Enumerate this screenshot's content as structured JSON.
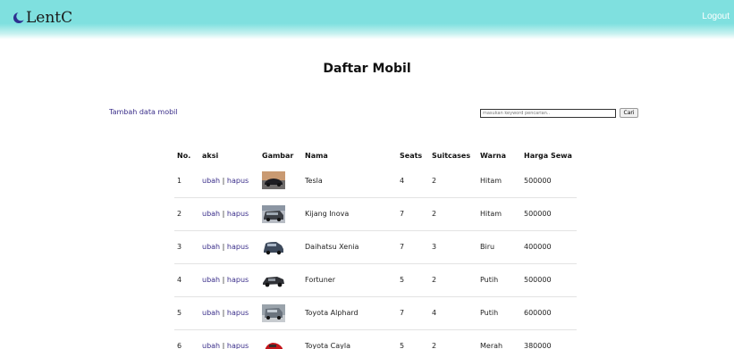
{
  "navbar": {
    "brand": "LentC",
    "brand_icon": "crescent-moon-icon",
    "logout_label": "Logout",
    "bg_color": "#7fe0df"
  },
  "page": {
    "title": "Daftar Mobil",
    "add_link": "Tambah data mobil"
  },
  "search": {
    "placeholder": "masukan keyword pencarian..",
    "button_label": "Cari"
  },
  "table": {
    "headers": {
      "no": "No.",
      "aksi": "aksi",
      "gambar": "Gambar",
      "nama": "Nama",
      "seats": "Seats",
      "suitcases": "Suitcases",
      "warna": "Warna",
      "harga": "Harga Sewa"
    },
    "action_edit": "ubah",
    "action_separator": "|",
    "action_delete": "hapus",
    "rows": [
      {
        "no": "1",
        "nama": "Tesla",
        "seats": "4",
        "suitcases": "2",
        "warna": "Hitam",
        "harga": "500000",
        "image": "tesla-photo"
      },
      {
        "no": "2",
        "nama": "Kijang Inova",
        "seats": "7",
        "suitcases": "2",
        "warna": "Hitam",
        "harga": "500000",
        "image": "kijang-photo"
      },
      {
        "no": "3",
        "nama": "Daihatsu Xenia",
        "seats": "7",
        "suitcases": "3",
        "warna": "Biru",
        "harga": "400000",
        "image": "xenia-photo"
      },
      {
        "no": "4",
        "nama": "Fortuner",
        "seats": "5",
        "suitcases": "2",
        "warna": "Putih",
        "harga": "500000",
        "image": "fortuner-photo"
      },
      {
        "no": "5",
        "nama": "Toyota Alphard",
        "seats": "7",
        "suitcases": "4",
        "warna": "Putih",
        "harga": "600000",
        "image": "alphard-photo"
      },
      {
        "no": "6",
        "nama": "Toyota Cayla",
        "seats": "5",
        "suitcases": "2",
        "warna": "Merah",
        "harga": "380000",
        "image": "cayla-photo"
      }
    ]
  },
  "colors": {
    "link": "#3a2e8a",
    "row_border": "#e3e3e3"
  }
}
